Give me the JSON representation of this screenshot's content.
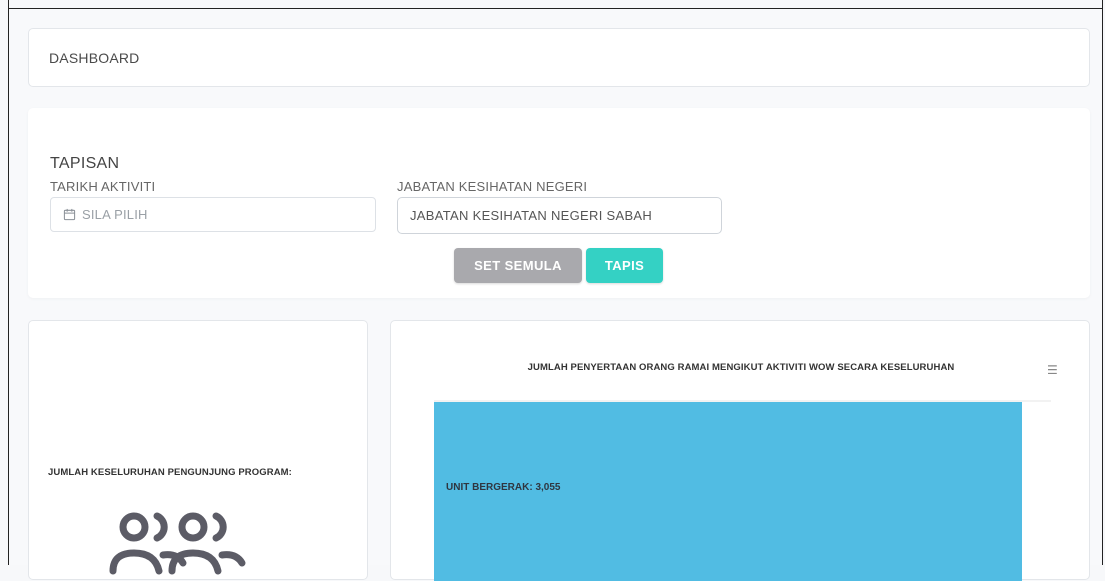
{
  "header": {
    "title": "DASHBOARD"
  },
  "filter": {
    "heading": "TAPISAN",
    "date_label": "TARIKH AKTIVITI",
    "date_placeholder": "SILA PILIH",
    "jkn_label": "JABATAN KESIHATAN NEGERI",
    "jkn_value": "JABATAN KESIHATAN NEGERI SABAH",
    "reset_label": "SET SEMULA",
    "apply_label": "TAPIS"
  },
  "visitors": {
    "label": "JUMLAH KESELURUHAN PENGUNJUNG PROGRAM:",
    "icon": "people-group-icon"
  },
  "chart_menu_icon": "hamburger-menu-icon",
  "chart_data": {
    "type": "bar",
    "orientation": "horizontal",
    "title": "JUMLAH PENYERTAAN ORANG RAMAI MENGIKUT AKTIVITI WOW SECARA KESELURUHAN",
    "categories": [
      "UNIT BERGERAK"
    ],
    "values": [
      3055
    ],
    "data_labels": [
      "UNIT BERGERAK: 3,055"
    ],
    "bar_color": "#51bce3",
    "legend": "none",
    "grid": false
  }
}
